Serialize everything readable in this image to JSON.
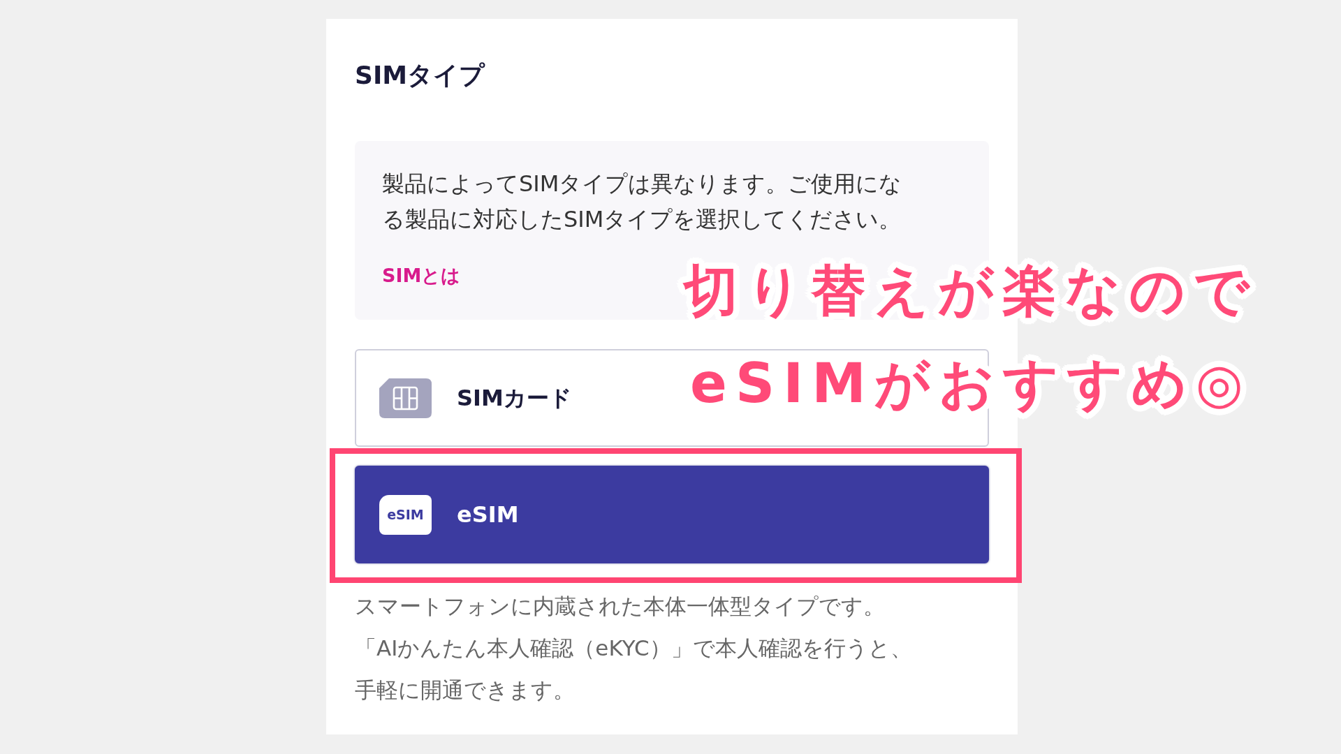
{
  "section": {
    "title": "SIMタイプ"
  },
  "info_box": {
    "text": "製品によってSIMタイプは異なります。ご使用になる製品に対応したSIMタイプを選択してください。",
    "link": "SIMとは"
  },
  "options": [
    {
      "kind": "chip",
      "label": "SIMカード",
      "selected": false,
      "highlighted": false
    },
    {
      "kind": "badge",
      "icon_text": "eSIM",
      "label": "eSIM",
      "selected": true,
      "highlighted": true
    }
  ],
  "description_lines": [
    "スマートフォンに内蔵された本体一体型タイプです。",
    "「AIかんたん本人確認（eKYC）」で本人確認を行うと、",
    "手軽に開通できます。"
  ],
  "annotation": {
    "lines": [
      "切り替えが楽なので",
      "eSIMがおすすめ◎"
    ]
  }
}
